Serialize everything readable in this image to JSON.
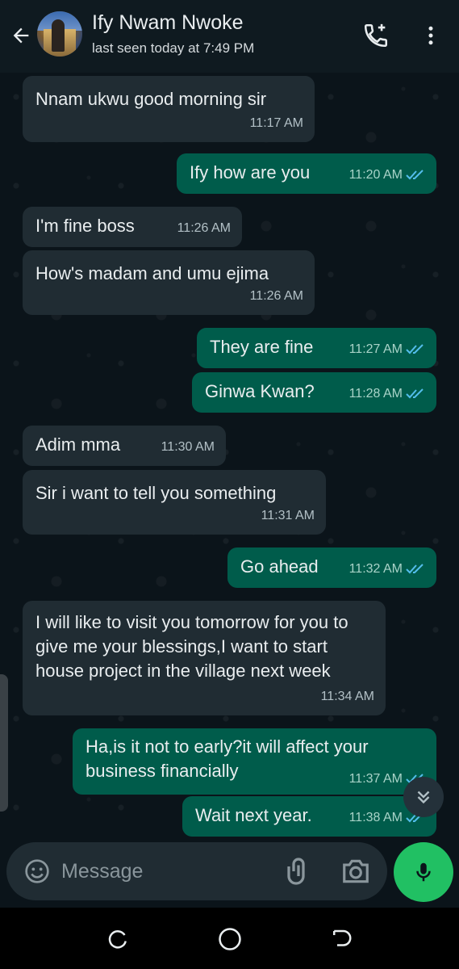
{
  "header": {
    "contact_name": "Ify Nwam Nwoke",
    "status": "last seen today at 7:49 PM",
    "icons": {
      "back": "arrow-left-icon",
      "call": "add-call-icon",
      "menu": "more-vert-icon"
    }
  },
  "messages": [
    {
      "dir": "in",
      "text": "Nnam ukwu good morning sir",
      "time": "11:17 AM"
    },
    {
      "dir": "out",
      "text": "Ify how are you",
      "time": "11:20 AM"
    },
    {
      "dir": "in",
      "text": "I'm fine boss",
      "time": "11:26 AM"
    },
    {
      "dir": "in",
      "text": "How's madam and umu ejima",
      "time": "11:26 AM"
    },
    {
      "dir": "out",
      "text": "They are fine",
      "time": "11:27 AM"
    },
    {
      "dir": "out",
      "text": "Ginwa Kwan?",
      "time": "11:28 AM"
    },
    {
      "dir": "in",
      "text": "Adim mma",
      "time": "11:30 AM"
    },
    {
      "dir": "in",
      "text": "Sir i want to tell you something",
      "time": "11:31 AM"
    },
    {
      "dir": "out",
      "text": "Go ahead",
      "time": "11:32 AM"
    },
    {
      "dir": "in",
      "text": "I will like to visit you tomorrow for you to give me your blessings,I want to start house project in the village next week",
      "time": "11:34 AM"
    },
    {
      "dir": "out",
      "text": "Ha,is it not to early?it will affect your business financially",
      "time": "11:37 AM"
    },
    {
      "dir": "out",
      "text": "Wait next year.",
      "time": "11:38 AM"
    }
  ],
  "composer": {
    "placeholder": "Message",
    "icons": [
      "emoji-icon",
      "attach-icon",
      "camera-icon",
      "mic-icon"
    ]
  },
  "colors": {
    "incoming_bubble": "#202c33",
    "outgoing_bubble": "#005c4b",
    "read_ticks": "#53bdeb",
    "mic_button": "#21c063"
  }
}
